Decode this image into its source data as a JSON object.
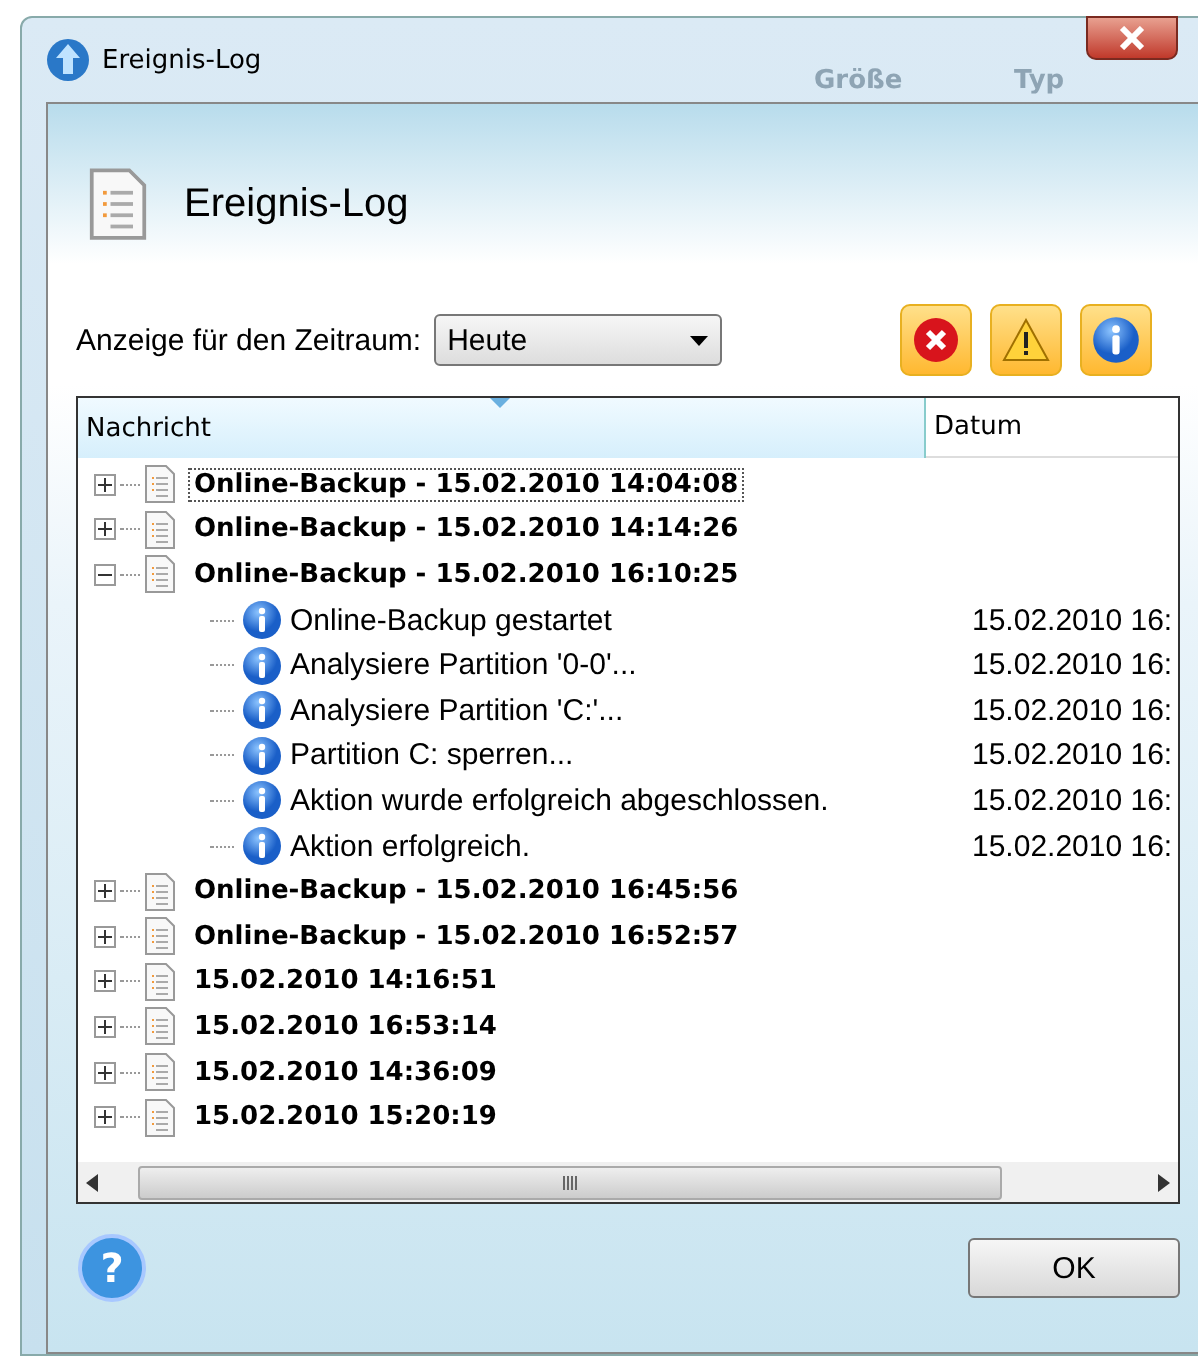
{
  "window": {
    "title": "Ereignis-Log",
    "background_texts": [
      "Größe",
      "Typ"
    ]
  },
  "header": {
    "title": "Ereignis-Log"
  },
  "filter": {
    "label": "Anzeige für den Zeitraum:",
    "value": "Heute"
  },
  "type_filters": [
    {
      "kind": "error",
      "selected": true
    },
    {
      "kind": "warning",
      "selected": true
    },
    {
      "kind": "info",
      "selected": true
    }
  ],
  "table": {
    "columns": [
      "Nachricht",
      "Datum"
    ],
    "rows": [
      {
        "message": "Online-Backup - 15.02.2010 14:04:08",
        "expanded": false,
        "selected": true,
        "children": []
      },
      {
        "message": "Online-Backup - 15.02.2010 14:14:26",
        "expanded": false,
        "selected": false,
        "children": []
      },
      {
        "message": "Online-Backup - 15.02.2010 16:10:25",
        "expanded": true,
        "selected": false,
        "children": [
          {
            "message": "Online-Backup gestartet",
            "date": "15.02.2010 16:"
          },
          {
            "message": "Analysiere Partition '0-0'...",
            "date": "15.02.2010 16:"
          },
          {
            "message": "Analysiere Partition 'C:'...",
            "date": "15.02.2010 16:"
          },
          {
            "message": "Partition C: sperren...",
            "date": "15.02.2010 16:"
          },
          {
            "message": "Aktion wurde erfolgreich abgeschlossen.",
            "date": "15.02.2010 16:"
          },
          {
            "message": "Aktion erfolgreich.",
            "date": "15.02.2010 16:"
          }
        ]
      },
      {
        "message": "Online-Backup - 15.02.2010 16:45:56",
        "expanded": false,
        "selected": false,
        "children": []
      },
      {
        "message": "Online-Backup - 15.02.2010 16:52:57",
        "expanded": false,
        "selected": false,
        "children": []
      },
      {
        "message": "15.02.2010 14:16:51",
        "expanded": false,
        "selected": false,
        "children": []
      },
      {
        "message": "15.02.2010 16:53:14",
        "expanded": false,
        "selected": false,
        "children": []
      },
      {
        "message": "15.02.2010 14:36:09",
        "expanded": false,
        "selected": false,
        "children": []
      },
      {
        "message": "15.02.2010 15:20:19",
        "expanded": false,
        "selected": false,
        "children": []
      }
    ]
  },
  "help_button": {
    "label": "?"
  },
  "buttons": [
    "OK"
  ]
}
